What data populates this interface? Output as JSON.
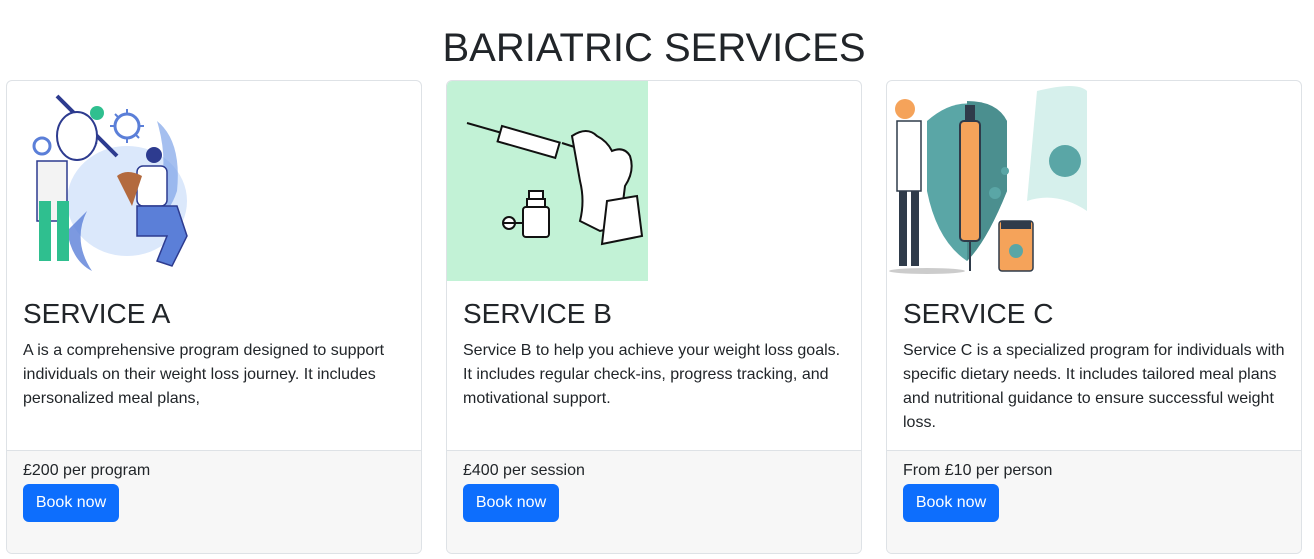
{
  "page": {
    "title": "BARIATRIC SERVICES"
  },
  "services": [
    {
      "title": "SERVICE A",
      "description": "A is a comprehensive program designed to support individuals on their weight loss journey. It includes personalized meal plans,",
      "price": "£200 per program",
      "button_label": "Book now"
    },
    {
      "title": "SERVICE B",
      "description": "Service B to help you achieve your weight loss goals. It includes regular check-ins, progress tracking, and motivational support.",
      "price": "£400 per session",
      "button_label": "Book now"
    },
    {
      "title": "SERVICE C",
      "description": "Service C is a specialized program for individuals with specific dietary needs. It includes tailored meal plans and nutritional guidance to ensure successful weight loss.",
      "price": "From £10 per person",
      "button_label": "Book now"
    }
  ],
  "colors": {
    "button": "#0d6efd",
    "footer_bg": "#f7f7f7",
    "card_b_image_bg": "#c2f2d6",
    "card_c_accent": "#5aa6a6"
  }
}
